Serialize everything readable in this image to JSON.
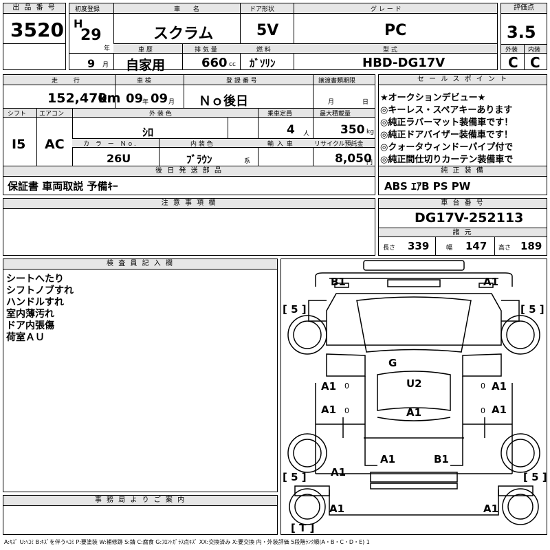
{
  "lot": {
    "label": "出 品 番 号",
    "value": "3520"
  },
  "first_reg": {
    "label": "初度登録",
    "era": "H",
    "year": "29",
    "year_unit": "年",
    "month": "9",
    "month_unit": "月"
  },
  "car_name": {
    "label": "車 名",
    "value": "スクラム"
  },
  "door": {
    "label": "ドア形状",
    "value": "5V"
  },
  "grade": {
    "label": "グ レ ー ド",
    "value": "PC"
  },
  "score": {
    "label": "評価点",
    "value": "3.5",
    "ext_label": "外装",
    "int_label": "内装",
    "ext": "C",
    "int": "C"
  },
  "history": {
    "label": "車 歴",
    "value": "自家用"
  },
  "displacement": {
    "label": "排 気 量",
    "value": "660",
    "unit": "cc"
  },
  "fuel": {
    "label": "燃 料",
    "value": "ｶﾞｿﾘﾝ"
  },
  "model": {
    "label": "型 式",
    "value": "HBD-DG17V"
  },
  "mileage": {
    "label": "走 行",
    "value": "152,470",
    "unit": "km"
  },
  "inspection": {
    "label": "車 検",
    "year": "09",
    "year_unit": "年",
    "month": "09",
    "month_unit": "月"
  },
  "reg_no": {
    "label": "登 録 番 号",
    "value": "Ｎｏ後日"
  },
  "transfer": {
    "label": "譲渡書類期限",
    "month_unit": "月",
    "day_unit": "日"
  },
  "shift": {
    "label": "シフト",
    "value": "I5"
  },
  "ac": {
    "label": "エアコン",
    "value": "AC"
  },
  "ext_color": {
    "label": "外 装 色",
    "value": "ｼﾛ"
  },
  "capacity": {
    "label": "乗車定員",
    "value": "4",
    "unit": "人"
  },
  "max_load": {
    "label": "最大積載量",
    "value": "350",
    "unit": "kg"
  },
  "color_no": {
    "label": "カ ラ ー Ｎo.",
    "value": "26U"
  },
  "int_color": {
    "label": "内 装 色",
    "value": "ﾌﾞﾗｳﾝ",
    "unit": "系"
  },
  "import": {
    "label": "輸 入 車",
    "value": ""
  },
  "recycle": {
    "label": "リサイクル預託金",
    "value": "8,050",
    "unit": "円"
  },
  "later_parts": {
    "label": "後 日 発 送 部 品",
    "value": "保証書 車両取説 予備ｷｰ"
  },
  "sales_points": {
    "label": "セ ー ル ス ポ イ ン ト",
    "items": [
      "★オークションデビュー★",
      "◎キーレス・スペアキーあります",
      "◎純正ラバーマット装備車です！",
      "◎純正ドアバイザー装備車です！",
      "◎クォータウィンドーパイプ付で",
      "◎純正間仕切りカーテン装備車で"
    ]
  },
  "equipment": {
    "label": "純 正 装 備",
    "value": "ABS ｴｱB PS PW"
  },
  "notes": {
    "label": "注 意 事 項 欄",
    "value": ""
  },
  "chassis": {
    "label": "車 台 番 号",
    "value": "DG17V-252113"
  },
  "dims": {
    "label": "諸 元",
    "length_label": "長さ",
    "length": "339",
    "width_label": "幅",
    "width": "147",
    "height_label": "高さ",
    "height": "189"
  },
  "inspector": {
    "label": "検 査 員 記 入 欄",
    "lines": [
      "シートへたり",
      "シフトノブすれ",
      "ハンドルすれ",
      "室内薄汚れ",
      "ドア内張傷",
      "荷室ＡＵ"
    ]
  },
  "office": {
    "label": "事 務 局 よ り ご 案 内",
    "value": ""
  },
  "diagram": {
    "tire_fl": "[ 5 ]",
    "tire_fr": "[ 5 ]",
    "tire_rl": "[ 5 ]",
    "tire_rr": "[ 5 ]",
    "spare": "[ T ]",
    "marks": [
      "B1",
      "A1",
      "G",
      "U2",
      "A1",
      "A1",
      "A1",
      "A1",
      "A1",
      "A1",
      "B1",
      "A1",
      "A1",
      "A1"
    ]
  },
  "legend": "A:ｷｽﾞ  U:ﾍｺﾐ  B:ｷｽﾞを伴うﾍｺﾐ  P:要塗装  W:補修跡  S:錆  C:腐食  G:ﾌﾛﾝﾄｶﾞﾗｽ点ｷｽﾞ  XX:交換済み  X:要交換  内・外装評価  5段階ﾗﾝｸ順(A・B・C・D・E) 1"
}
